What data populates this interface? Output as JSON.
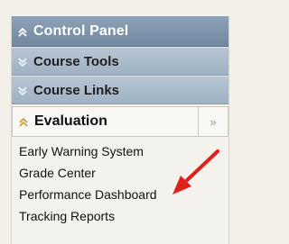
{
  "control_panel": {
    "title": "Control Panel",
    "header_icon": "double-chevron-up-icon"
  },
  "sections": [
    {
      "label": "Course Tools",
      "icon": "double-chevron-down-icon"
    },
    {
      "label": "Course Links",
      "icon": "double-chevron-down-icon"
    }
  ],
  "evaluation": {
    "label": "Evaluation",
    "icon": "double-chevron-up-icon",
    "collapse_glyph": "»",
    "items": [
      {
        "label": "Early Warning System"
      },
      {
        "label": "Grade Center"
      },
      {
        "label": "Performance Dashboard"
      },
      {
        "label": "Tracking Reports"
      }
    ]
  },
  "colors": {
    "header": "#7f95ad",
    "section": "#aebfcd",
    "annotation_arrow": "#e0201a",
    "expanded_icon": "#c8a038"
  }
}
